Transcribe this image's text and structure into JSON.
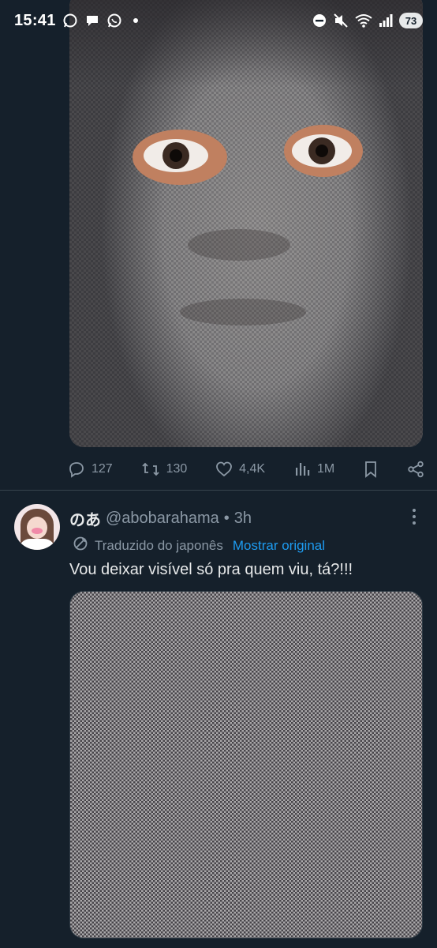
{
  "status_bar": {
    "time": "15:41",
    "battery": "73"
  },
  "top_tweet": {
    "actions": {
      "replies": "127",
      "reposts": "130",
      "likes": "4,4K",
      "views": "1M"
    }
  },
  "tweet": {
    "display_name": "のあ",
    "handle": "@abobarahama",
    "separator": "•",
    "time": "3h",
    "translated_label": "Traduzido do japonês",
    "show_original": "Mostrar original",
    "text": "Vou deixar visível só pra quem viu, tá?!!!"
  },
  "colors": {
    "background": "#15202b",
    "text_primary": "#e7e9ea",
    "text_secondary": "#8b98a5",
    "link": "#1d9bf0",
    "divider": "#38444d"
  },
  "icons": {
    "status_left": [
      "whatsapp-icon",
      "chat-bubble-icon",
      "whatsapp-icon",
      "notification-dot"
    ],
    "status_right": [
      "do-not-disturb-icon",
      "mute-icon",
      "wifi-icon",
      "signal-icon",
      "battery-icon"
    ],
    "actions": [
      "reply-icon",
      "repost-icon",
      "like-icon",
      "views-icon",
      "bookmark-icon",
      "share-icon"
    ]
  }
}
